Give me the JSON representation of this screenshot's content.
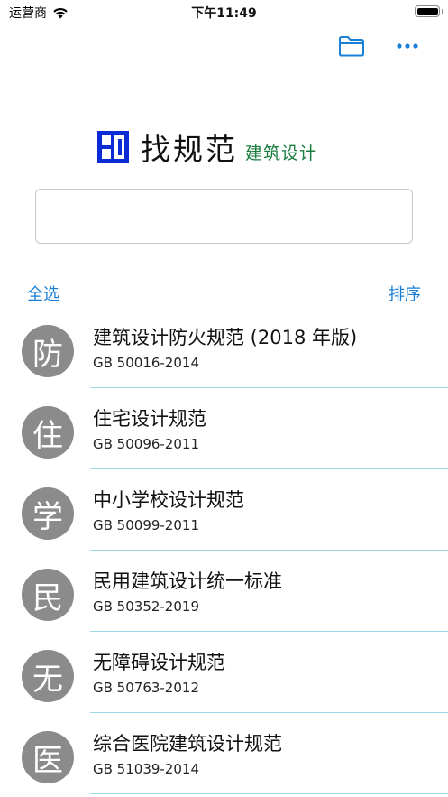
{
  "status_bar": {
    "carrier": "运营商",
    "time": "下午11:49"
  },
  "header": {
    "folder_icon": "folder-icon",
    "more_icon": "ellipsis-icon",
    "accent_color": "#1a7fd6"
  },
  "logo": {
    "mark": "BD",
    "title": "找规范",
    "subtitle": "建筑设计",
    "subtitle_color": "#1a7d3f",
    "mark_color": "#0a2bd6"
  },
  "search": {
    "value": "",
    "placeholder": ""
  },
  "toolbar": {
    "select_all": "全选",
    "sort": "排序"
  },
  "standards": [
    {
      "char": "防",
      "title": "建筑设计防火规范 (2018 年版)",
      "code": "GB 50016-2014"
    },
    {
      "char": "住",
      "title": "住宅设计规范",
      "code": "GB 50096-2011"
    },
    {
      "char": "学",
      "title": "中小学校设计规范",
      "code": "GB 50099-2011"
    },
    {
      "char": "民",
      "title": "民用建筑设计统一标准",
      "code": "GB 50352-2019"
    },
    {
      "char": "无",
      "title": "无障碍设计规范",
      "code": "GB 50763-2012"
    },
    {
      "char": "医",
      "title": "综合医院建筑设计规范",
      "code": "GB 51039-2014"
    }
  ]
}
